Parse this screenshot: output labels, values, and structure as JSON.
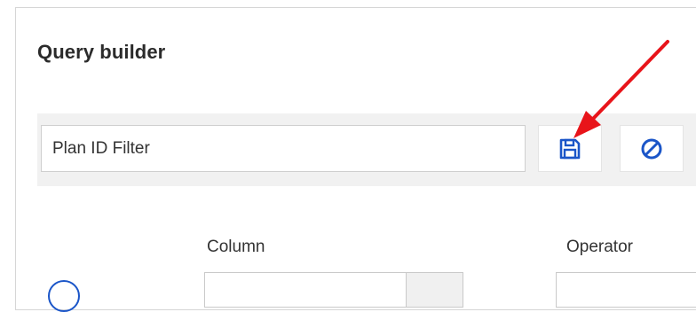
{
  "query_builder": {
    "title": "Query builder",
    "filter_name_value": "Plan ID Filter",
    "save_icon": "save-icon",
    "clear_icon": "cancel-icon",
    "column_label": "Column",
    "operator_label": "Operator"
  },
  "colors": {
    "accent": "#1a55c8",
    "annotation_arrow": "#e8141a"
  }
}
